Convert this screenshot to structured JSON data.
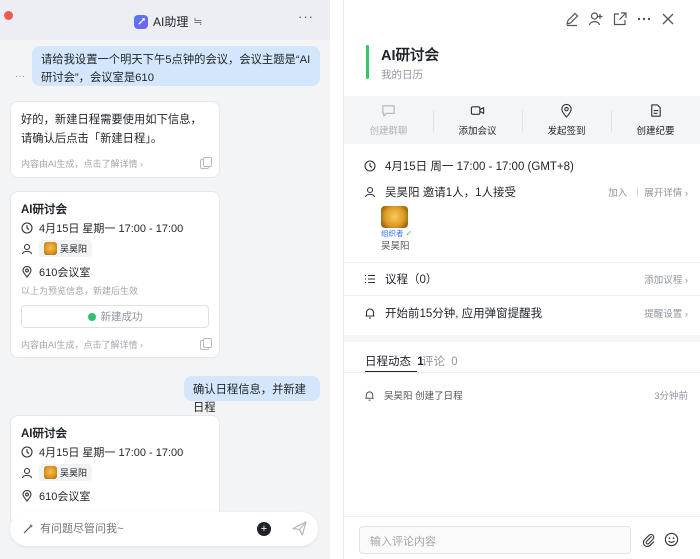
{
  "assistant": {
    "title": "AI助理",
    "title_suffix": "≒",
    "more": "···"
  },
  "chat": {
    "user_msg_1": "请给我设置一个明天下午5点钟的会议，会议主题是“AI研讨会”，会议室是610",
    "user_msg_1_dots": "···",
    "ai_reply_1": "好的，新建日程需要使用如下信息，请确认后点击「新建日程」。",
    "ai_footer": "内容由AI生成，点击了解详情 ›",
    "event_card_1": {
      "title": "AI研讨会",
      "time": "4月15日 星期一 17:00 - 17:00",
      "person": "吴昊阳",
      "room": "610会议室",
      "note": "以上为预览信息，新建后生效",
      "button": "新建成功"
    },
    "user_msg_2": "确认日程信息，并新建日程",
    "event_card_2": {
      "title": "AI研讨会",
      "time": "4月15日 星期一 17:00 - 17:00",
      "person": "吴昊阳",
      "room": "610会议室"
    },
    "input_placeholder": "有问题尽管问我~"
  },
  "detail": {
    "title": "AI研讨会",
    "calendar": "我的日历",
    "actions": [
      {
        "label": "创建群聊",
        "icon": "chat-bubble-icon",
        "enabled": false
      },
      {
        "label": "添加会议",
        "icon": "video-camera-icon",
        "enabled": true
      },
      {
        "label": "发起签到",
        "icon": "location-pin-icon",
        "enabled": true
      },
      {
        "label": "创建纪要",
        "icon": "document-icon",
        "enabled": true
      }
    ],
    "time": "4月15日 周一 17:00 - 17:00 (GMT+8)",
    "invite": "吴昊阳 邀请1人，1人接受",
    "invite_join": "加入",
    "invite_expand": "展开详情 ›",
    "organizer_badge": "组织者",
    "organizer_name": "吴昊阳",
    "agenda": "议程（0）",
    "agenda_add": "添加议程 ›",
    "reminder": "开始前15分钟, 应用弹窗提醒我",
    "reminder_setting": "提醒设置 ›",
    "tab_activity": "日程动态",
    "tab_activity_count": "1",
    "tab_comment": "评论",
    "tab_comment_count": "0",
    "activity": {
      "text": "吴昊阳 创建了日程",
      "time": "3分钟前"
    },
    "comment_placeholder": "输入评论内容"
  },
  "colors": {
    "accent_green": "#35c46a",
    "user_bubble": "#d4e6fc",
    "brand_blue": "#3370ff"
  }
}
